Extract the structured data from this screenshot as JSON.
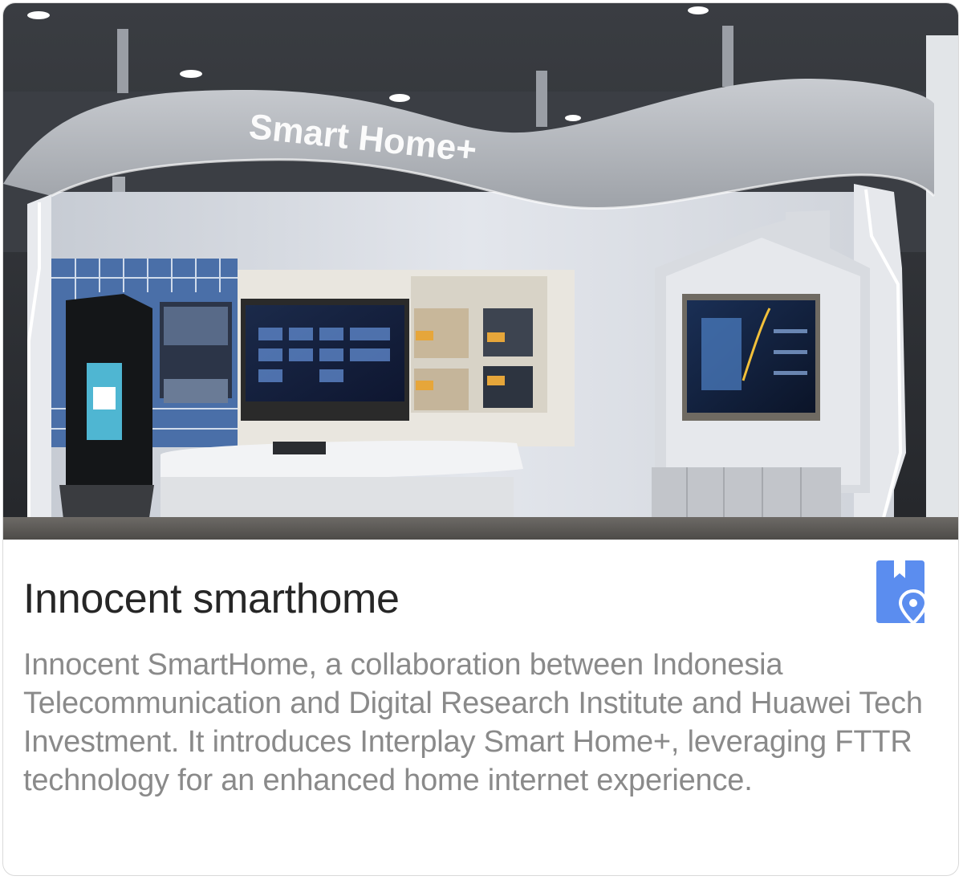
{
  "photo": {
    "sign_text": "Smart Home+",
    "icon": "smart-home-showroom-photo"
  },
  "card": {
    "title": "Innocent smarthome",
    "description": "Innocent SmartHome, a collaboration between Indonesia Telecommunication and Digital Research Institute and Huawei Tech Investment. It introduces Interplay Smart Home+, leveraging FTTR technology for an enhanced home internet experience.",
    "save_icon": "bookmark-location-icon",
    "accent_color": "#5B8DEF"
  }
}
